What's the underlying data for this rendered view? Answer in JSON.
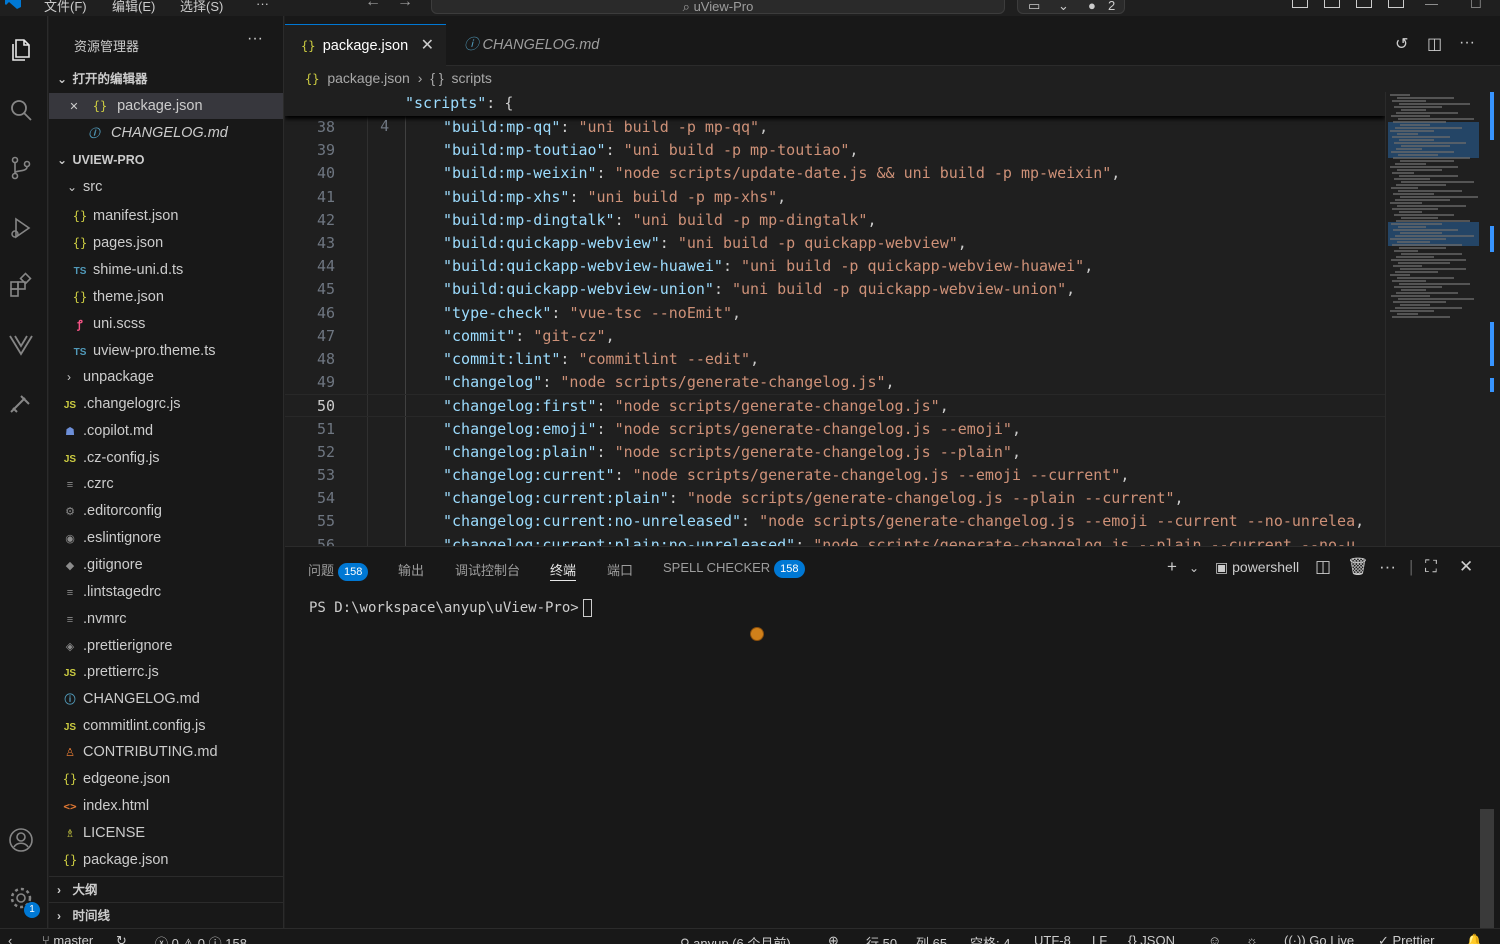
{
  "titlebar": {
    "menus": [
      "文件(F)",
      "编辑(E)",
      "选择(S)",
      "···"
    ],
    "search_text": "uView-Pro",
    "chat_count": "2"
  },
  "sidebar": {
    "title": "资源管理器",
    "more": "···",
    "open_editors_label": "打开的编辑器",
    "open_editors": [
      {
        "name": "package.json",
        "icon": "json-icon"
      },
      {
        "name": "CHANGELOG.md",
        "icon": "markdown-icon"
      }
    ],
    "project_label": "UVIEW-PRO",
    "src_label": "src",
    "src_files": [
      {
        "name": "manifest.json",
        "icon": "json"
      },
      {
        "name": "pages.json",
        "icon": "json"
      },
      {
        "name": "shime-uni.d.ts",
        "icon": "ts"
      },
      {
        "name": "theme.json",
        "icon": "json"
      },
      {
        "name": "uni.scss",
        "icon": "sass"
      },
      {
        "name": "uview-pro.theme.ts",
        "icon": "ts"
      }
    ],
    "unpackage_label": "unpackage",
    "root_files": [
      {
        "name": ".changelogrc.js",
        "icon": "js"
      },
      {
        "name": ".copilot.md",
        "icon": "copilot"
      },
      {
        "name": ".cz-config.js",
        "icon": "js"
      },
      {
        "name": ".czrc",
        "icon": "config"
      },
      {
        "name": ".editorconfig",
        "icon": "gear"
      },
      {
        "name": ".eslintignore",
        "icon": "eslint"
      },
      {
        "name": ".gitignore",
        "icon": "git"
      },
      {
        "name": ".lintstagedrc",
        "icon": "config"
      },
      {
        "name": ".nvmrc",
        "icon": "config"
      },
      {
        "name": ".prettierignore",
        "icon": "prettier"
      },
      {
        "name": ".prettierrc.js",
        "icon": "js"
      },
      {
        "name": "CHANGELOG.md",
        "icon": "markdown"
      },
      {
        "name": "commitlint.config.js",
        "icon": "js"
      },
      {
        "name": "CONTRIBUTING.md",
        "icon": "contrib"
      },
      {
        "name": "edgeone.json",
        "icon": "json"
      },
      {
        "name": "index.html",
        "icon": "html"
      },
      {
        "name": "LICENSE",
        "icon": "license"
      },
      {
        "name": "package.json",
        "icon": "json"
      }
    ],
    "outline_label": "大纲",
    "timeline_label": "时间线"
  },
  "tabs": [
    {
      "label": "package.json",
      "active": true
    },
    {
      "label": "CHANGELOG.md",
      "active": false
    }
  ],
  "breadcrumb": {
    "file": "package.json",
    "symbol": "scripts"
  },
  "editor": {
    "sticky": {
      "line": "4",
      "key": "\"scripts\"",
      "rest": ": {"
    },
    "current_line": 50,
    "lines": [
      {
        "n": "38",
        "k": "\"build:mp-qq\"",
        "v": "\"uni build -p mp-qq\""
      },
      {
        "n": "39",
        "k": "\"build:mp-toutiao\"",
        "v": "\"uni build -p mp-toutiao\""
      },
      {
        "n": "40",
        "k": "\"build:mp-weixin\"",
        "v": "\"node scripts/update-date.js && uni build -p mp-weixin\""
      },
      {
        "n": "41",
        "k": "\"build:mp-xhs\"",
        "v": "\"uni build -p mp-xhs\""
      },
      {
        "n": "42",
        "k": "\"build:mp-dingtalk\"",
        "v": "\"uni build -p mp-dingtalk\""
      },
      {
        "n": "43",
        "k": "\"build:quickapp-webview\"",
        "v": "\"uni build -p quickapp-webview\""
      },
      {
        "n": "44",
        "k": "\"build:quickapp-webview-huawei\"",
        "v": "\"uni build -p quickapp-webview-huawei\""
      },
      {
        "n": "45",
        "k": "\"build:quickapp-webview-union\"",
        "v": "\"uni build -p quickapp-webview-union\""
      },
      {
        "n": "46",
        "k": "\"type-check\"",
        "v": "\"vue-tsc --noEmit\""
      },
      {
        "n": "47",
        "k": "\"commit\"",
        "v": "\"git-cz\""
      },
      {
        "n": "48",
        "k": "\"commit:lint\"",
        "v": "\"commitlint --edit\""
      },
      {
        "n": "49",
        "k": "\"changelog\"",
        "v": "\"node scripts/generate-changelog.js\""
      },
      {
        "n": "50",
        "k": "\"changelog:first\"",
        "v": "\"node scripts/generate-changelog.js\""
      },
      {
        "n": "51",
        "k": "\"changelog:emoji\"",
        "v": "\"node scripts/generate-changelog.js --emoji\""
      },
      {
        "n": "52",
        "k": "\"changelog:plain\"",
        "v": "\"node scripts/generate-changelog.js --plain\""
      },
      {
        "n": "53",
        "k": "\"changelog:current\"",
        "v": "\"node scripts/generate-changelog.js --emoji --current\""
      },
      {
        "n": "54",
        "k": "\"changelog:current:plain\"",
        "v": "\"node scripts/generate-changelog.js --plain --current\""
      },
      {
        "n": "55",
        "k": "\"changelog:current:no-unreleased\"",
        "v": "\"node scripts/generate-changelog.js --emoji --current --no-unrelea"
      },
      {
        "n": "56",
        "k": "\"changelog:current:plain:no-unreleased\"",
        "v": "\"node scripts/generate-changelog.js --plain --current --no-u"
      }
    ]
  },
  "panel": {
    "tabs": [
      {
        "label": "问题",
        "badge": "158"
      },
      {
        "label": "输出",
        "badge": ""
      },
      {
        "label": "调试控制台",
        "badge": ""
      },
      {
        "label": "终端",
        "badge": "",
        "active": true
      },
      {
        "label": "端口",
        "badge": ""
      },
      {
        "label": "SPELL CHECKER",
        "badge": "158"
      }
    ],
    "shell": "powershell",
    "prompt": "PS D:\\workspace\\anyup\\uView-Pro>"
  },
  "statusbar": {
    "branch": "master",
    "errors": "0",
    "warnings": "0",
    "infos": "158",
    "git_author": "anyup (6 个月前)",
    "line": "行 50",
    "col": "列 65",
    "spaces": "空格: 4",
    "encoding": "UTF-8",
    "eol": "LF",
    "language": "JSON",
    "golive": "Go Live",
    "prettier": "Prettier"
  },
  "activity_badge": "1",
  "colors": {
    "accent": "#0078d4",
    "key": "#9cdcfe",
    "string": "#ce9178"
  }
}
